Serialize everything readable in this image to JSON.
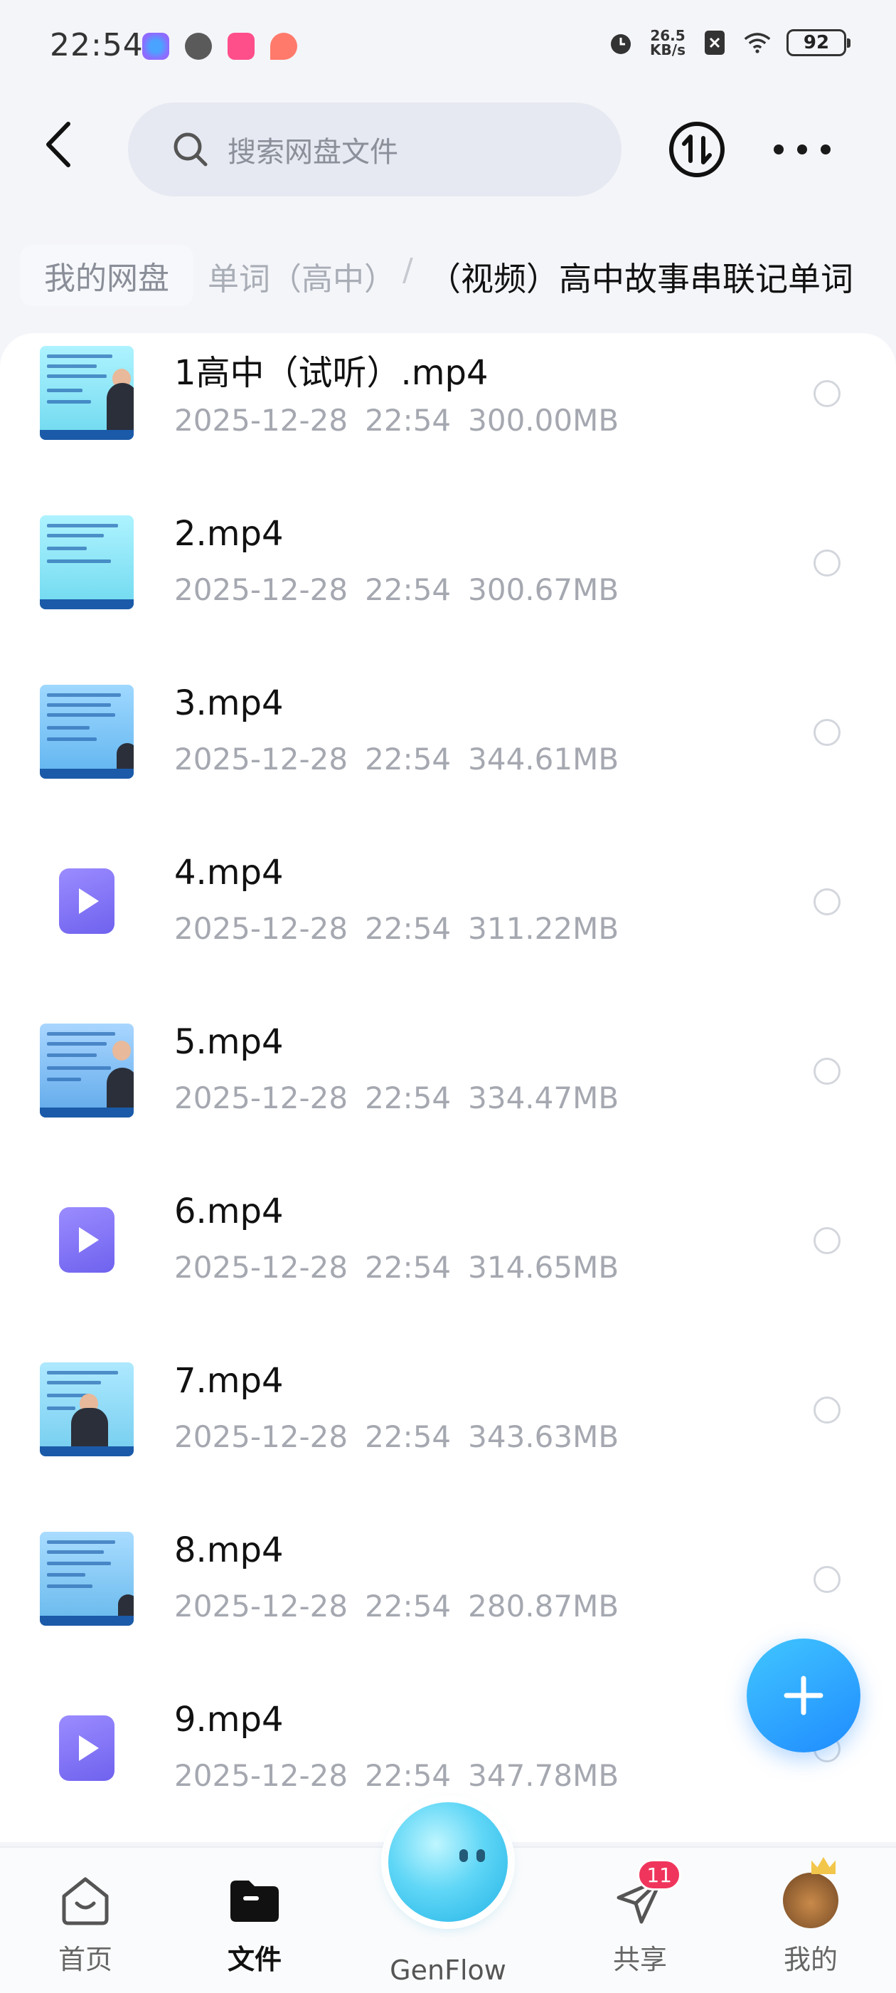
{
  "status_bar": {
    "time": "22:54",
    "net_speed_value": "26.5",
    "net_speed_unit": "KB/s",
    "battery": "92"
  },
  "header": {
    "search_placeholder": "搜索网盘文件"
  },
  "breadcrumb": {
    "root": "我的网盘",
    "middle": "单词（高中）",
    "separator": "/",
    "current": "（视频）高中故事串联记单词"
  },
  "files": [
    {
      "name": "1高中（试听）.mp4",
      "date": "2025-12-28",
      "time": "22:54",
      "size": "300.00MB",
      "thumb": "video"
    },
    {
      "name": "2.mp4",
      "date": "2025-12-28",
      "time": "22:54",
      "size": "300.67MB",
      "thumb": "video"
    },
    {
      "name": "3.mp4",
      "date": "2025-12-28",
      "time": "22:54",
      "size": "344.61MB",
      "thumb": "video"
    },
    {
      "name": "4.mp4",
      "date": "2025-12-28",
      "time": "22:54",
      "size": "311.22MB",
      "thumb": "play-icon"
    },
    {
      "name": "5.mp4",
      "date": "2025-12-28",
      "time": "22:54",
      "size": "334.47MB",
      "thumb": "video"
    },
    {
      "name": "6.mp4",
      "date": "2025-12-28",
      "time": "22:54",
      "size": "314.65MB",
      "thumb": "play-icon"
    },
    {
      "name": "7.mp4",
      "date": "2025-12-28",
      "time": "22:54",
      "size": "343.63MB",
      "thumb": "video"
    },
    {
      "name": "8.mp4",
      "date": "2025-12-28",
      "time": "22:54",
      "size": "280.87MB",
      "thumb": "video"
    },
    {
      "name": "9.mp4",
      "date": "2025-12-28",
      "time": "22:54",
      "size": "347.78MB",
      "thumb": "play-icon"
    }
  ],
  "bottom_nav": {
    "home": "首页",
    "files": "文件",
    "genflow": "GenFlow",
    "share": "共享",
    "share_badge": "11",
    "me": "我的"
  },
  "colors": {
    "accent": "#1f8bff",
    "badge": "#f0355c",
    "file_icon": "#6f62ee"
  }
}
